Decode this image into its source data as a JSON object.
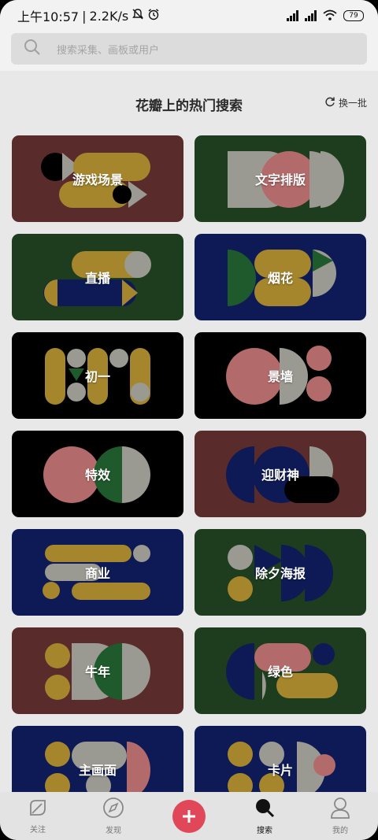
{
  "status_bar": {
    "time": "上午10:57",
    "net_speed": "2.2K/s",
    "battery": "79"
  },
  "search": {
    "placeholder": "搜索采集、画板或用户"
  },
  "section": {
    "title": "花瓣上的热门搜索",
    "refresh_label": "换一批"
  },
  "cards": [
    {
      "label": "游戏场景",
      "bg": "#5a2b2b"
    },
    {
      "label": "文字排版",
      "bg": "#1e3d1e"
    },
    {
      "label": "直播",
      "bg": "#1e3d1e"
    },
    {
      "label": "烟花",
      "bg": "#0e1a55"
    },
    {
      "label": "初一",
      "bg": "#000000"
    },
    {
      "label": "景墙",
      "bg": "#000000"
    },
    {
      "label": "特效",
      "bg": "#000000"
    },
    {
      "label": "迎财神",
      "bg": "#5a2b2b"
    },
    {
      "label": "商业",
      "bg": "#0e1a55"
    },
    {
      "label": "除夕海报",
      "bg": "#1e3d1e"
    },
    {
      "label": "牛年",
      "bg": "#5a2b2b"
    },
    {
      "label": "绿色",
      "bg": "#1e3d1e"
    },
    {
      "label": "主画面",
      "bg": "#0e1a55"
    },
    {
      "label": "卡片",
      "bg": "#0e1a55"
    }
  ],
  "nav": [
    {
      "label": "关注",
      "icon": "leaf-icon"
    },
    {
      "label": "发现",
      "icon": "compass-icon"
    },
    {
      "label": "",
      "icon": "plus-icon"
    },
    {
      "label": "搜索",
      "icon": "search-icon"
    },
    {
      "label": "我的",
      "icon": "user-icon"
    }
  ],
  "colors": {
    "accent": "#e0485a",
    "shape_yellow": "#a5862c",
    "shape_grey": "#9a9a92",
    "shape_pink": "#b36a6a"
  }
}
